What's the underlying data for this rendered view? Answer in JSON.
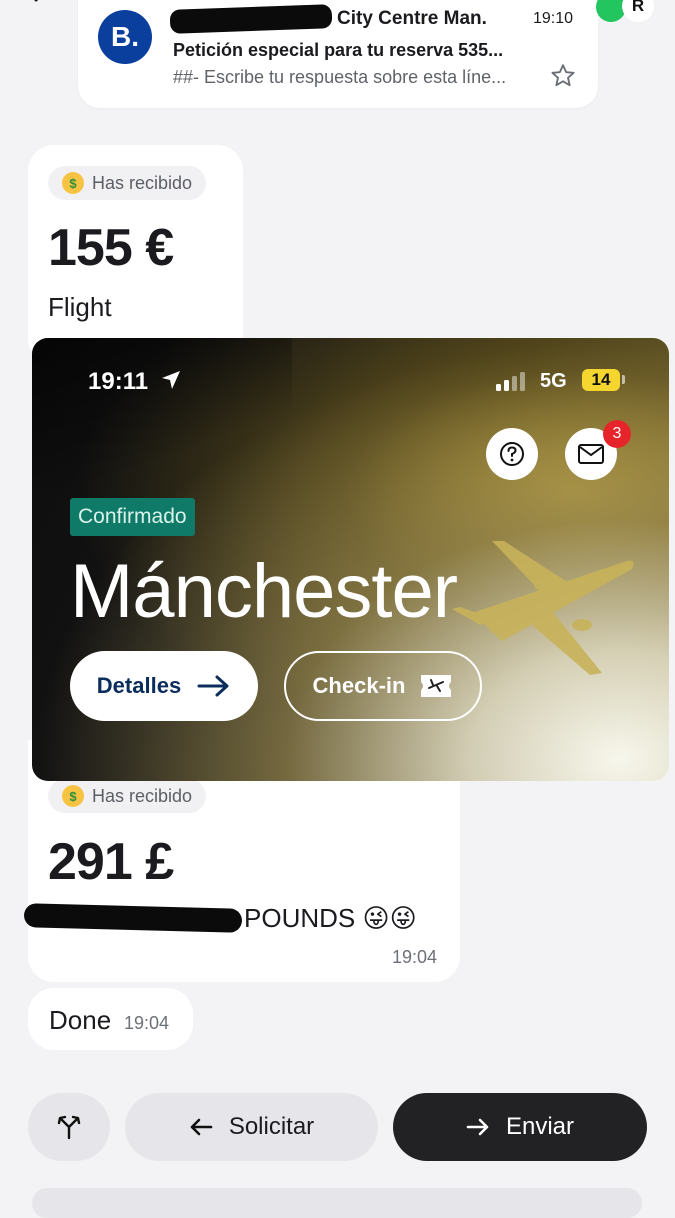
{
  "notification": {
    "avatar_letter": "B.",
    "sender": "City Centre Man.",
    "time": "19:10",
    "subject": "Petición especial para tu reserva 535...",
    "preview": "##- Escribe tu respuesta sobre esta líne..."
  },
  "top_right": {
    "app_letter": "R"
  },
  "messages": [
    {
      "badge": "Has recibido",
      "amount": "155 €",
      "description": "Flight"
    },
    {
      "badge": "Has recibido",
      "amount": "291 £",
      "description": "POUNDS 😜😜",
      "time": "19:04"
    },
    {
      "text": "Done",
      "time": "19:04"
    }
  ],
  "overlay": {
    "status_time": "19:11",
    "network": "5G",
    "battery": "14",
    "mail_badge": "3",
    "status_chip": "Confirmado",
    "destination": "Mánchester",
    "details_label": "Detalles",
    "checkin_label": "Check-in"
  },
  "actions": {
    "request_label": "Solicitar",
    "send_label": "Enviar"
  },
  "colors": {
    "brand_blue": "#0a3f9e",
    "confirmed_green": "#0f7a67",
    "badge_red": "#e5252a",
    "battery_yellow": "#f5d62f"
  }
}
